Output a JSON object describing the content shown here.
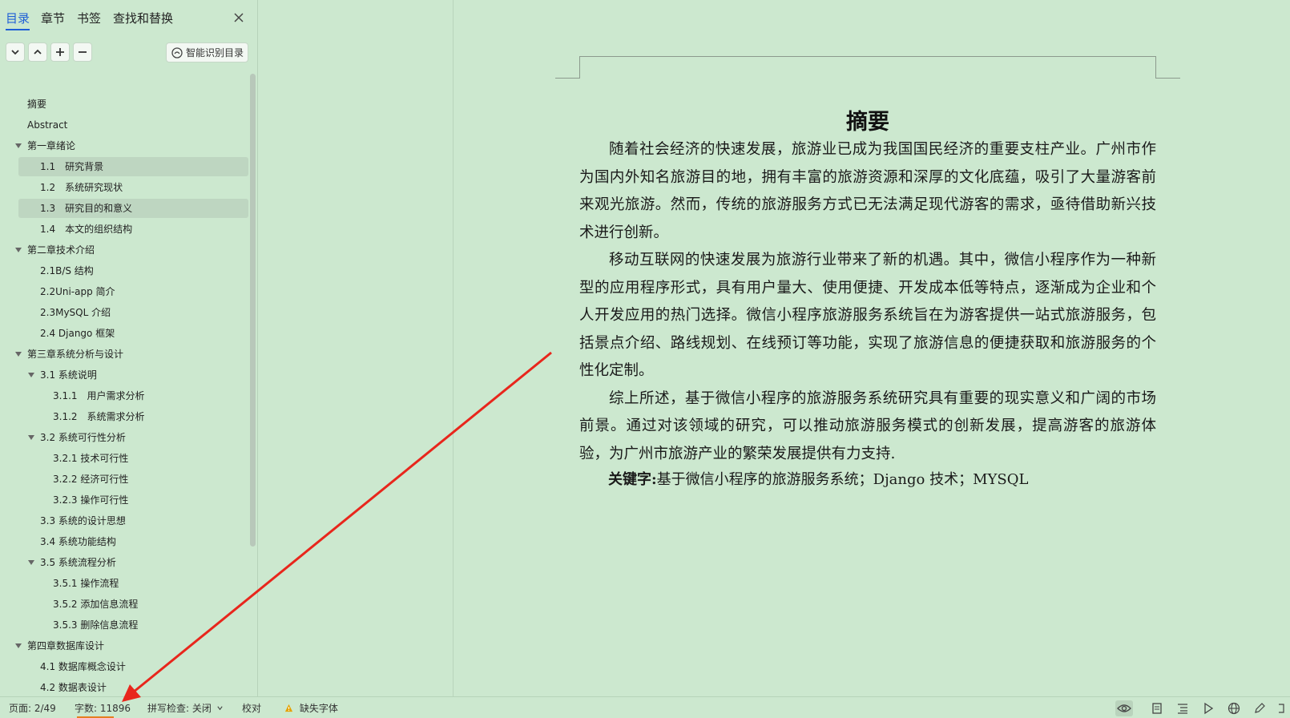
{
  "sidebar": {
    "tabs": [
      {
        "label": "目录",
        "active": true
      },
      {
        "label": "章节",
        "active": false
      },
      {
        "label": "书签",
        "active": false
      },
      {
        "label": "查找和替换",
        "active": false
      }
    ],
    "smart_toc_label": "智能识别目录",
    "toc": [
      {
        "label": "摘要",
        "level": 0,
        "arrow": false,
        "hl": false
      },
      {
        "label": "Abstract",
        "level": 0,
        "arrow": false,
        "hl": false
      },
      {
        "label": "第一章绪论",
        "level": 0,
        "arrow": true,
        "hl": false
      },
      {
        "label": "1.1　研究背景",
        "level": 1,
        "arrow": false,
        "hl": true
      },
      {
        "label": "1.2　系统研究现状",
        "level": 1,
        "arrow": false,
        "hl": false
      },
      {
        "label": "1.3　研究目的和意义",
        "level": 1,
        "arrow": false,
        "hl": true
      },
      {
        "label": "1.4　本文的组织结构",
        "level": 1,
        "arrow": false,
        "hl": false
      },
      {
        "label": "第二章技术介绍",
        "level": 0,
        "arrow": true,
        "hl": false
      },
      {
        "label": "2.1B/S 结构",
        "level": 1,
        "arrow": false,
        "hl": false
      },
      {
        "label": "2.2Uni-app 简介",
        "level": 1,
        "arrow": false,
        "hl": false
      },
      {
        "label": "2.3MySQL 介绍",
        "level": 1,
        "arrow": false,
        "hl": false
      },
      {
        "label": "2.4 Django 框架",
        "level": 1,
        "arrow": false,
        "hl": false
      },
      {
        "label": "第三章系统分析与设计",
        "level": 0,
        "arrow": true,
        "hl": false
      },
      {
        "label": "3.1 系统说明",
        "level": 1,
        "arrow": true,
        "hl": false
      },
      {
        "label": "3.1.1　用户需求分析",
        "level": 2,
        "arrow": false,
        "hl": false
      },
      {
        "label": "3.1.2　系统需求分析",
        "level": 2,
        "arrow": false,
        "hl": false
      },
      {
        "label": "3.2 系统可行性分析",
        "level": 1,
        "arrow": true,
        "hl": false
      },
      {
        "label": "3.2.1 技术可行性",
        "level": 2,
        "arrow": false,
        "hl": false
      },
      {
        "label": "3.2.2 经济可行性",
        "level": 2,
        "arrow": false,
        "hl": false
      },
      {
        "label": "3.2.3 操作可行性",
        "level": 2,
        "arrow": false,
        "hl": false
      },
      {
        "label": "3.3 系统的设计思想",
        "level": 1,
        "arrow": false,
        "hl": false
      },
      {
        "label": "3.4 系统功能结构",
        "level": 1,
        "arrow": false,
        "hl": false
      },
      {
        "label": "3.5 系统流程分析",
        "level": 1,
        "arrow": true,
        "hl": false
      },
      {
        "label": "3.5.1 操作流程",
        "level": 2,
        "arrow": false,
        "hl": false
      },
      {
        "label": "3.5.2 添加信息流程",
        "level": 2,
        "arrow": false,
        "hl": false
      },
      {
        "label": "3.5.3 删除信息流程",
        "level": 2,
        "arrow": false,
        "hl": false
      },
      {
        "label": "第四章数据库设计",
        "level": 0,
        "arrow": true,
        "hl": false
      },
      {
        "label": "4.1 数据库概念设计",
        "level": 1,
        "arrow": false,
        "hl": false
      },
      {
        "label": "4.2 数据表设计",
        "level": 1,
        "arrow": false,
        "hl": false
      }
    ]
  },
  "document": {
    "title": "摘要",
    "paragraphs": [
      "随着社会经济的快速发展，旅游业已成为我国国民经济的重要支柱产业。广州市作为国内外知名旅游目的地，拥有丰富的旅游资源和深厚的文化底蕴，吸引了大量游客前来观光旅游。然而，传统的旅游服务方式已无法满足现代游客的需求，亟待借助新兴技术进行创新。",
      "移动互联网的快速发展为旅游行业带来了新的机遇。其中，微信小程序作为一种新型的应用程序形式，具有用户量大、使用便捷、开发成本低等特点，逐渐成为企业和个人开发应用的热门选择。微信小程序旅游服务系统旨在为游客提供一站式旅游服务，包括景点介绍、路线规划、在线预订等功能，实现了旅游信息的便捷获取和旅游服务的个性化定制。",
      "综上所述，基于微信小程序的旅游服务系统研究具有重要的现实意义和广阔的市场前景。通过对该领域的研究，可以推动旅游服务模式的创新发展，提高游客的旅游体验，为广州市旅游产业的繁荣发展提供有力支持."
    ],
    "keywords_label": "关键字:",
    "keywords_text": "基于微信小程序的旅游服务系统；Django 技术；MYSQL"
  },
  "statusbar": {
    "page": "页面: 2/49",
    "words": "字数: 11896",
    "spellcheck": "拼写检查: 关闭",
    "proofread": "校对",
    "missing_font": "缺失字体"
  },
  "colors": {
    "background": "#cce8cf",
    "accent": "#1f5fd6",
    "highlight": "#bed6c1",
    "annotation_arrow": "#e8261c",
    "warning": "#e6a100"
  }
}
